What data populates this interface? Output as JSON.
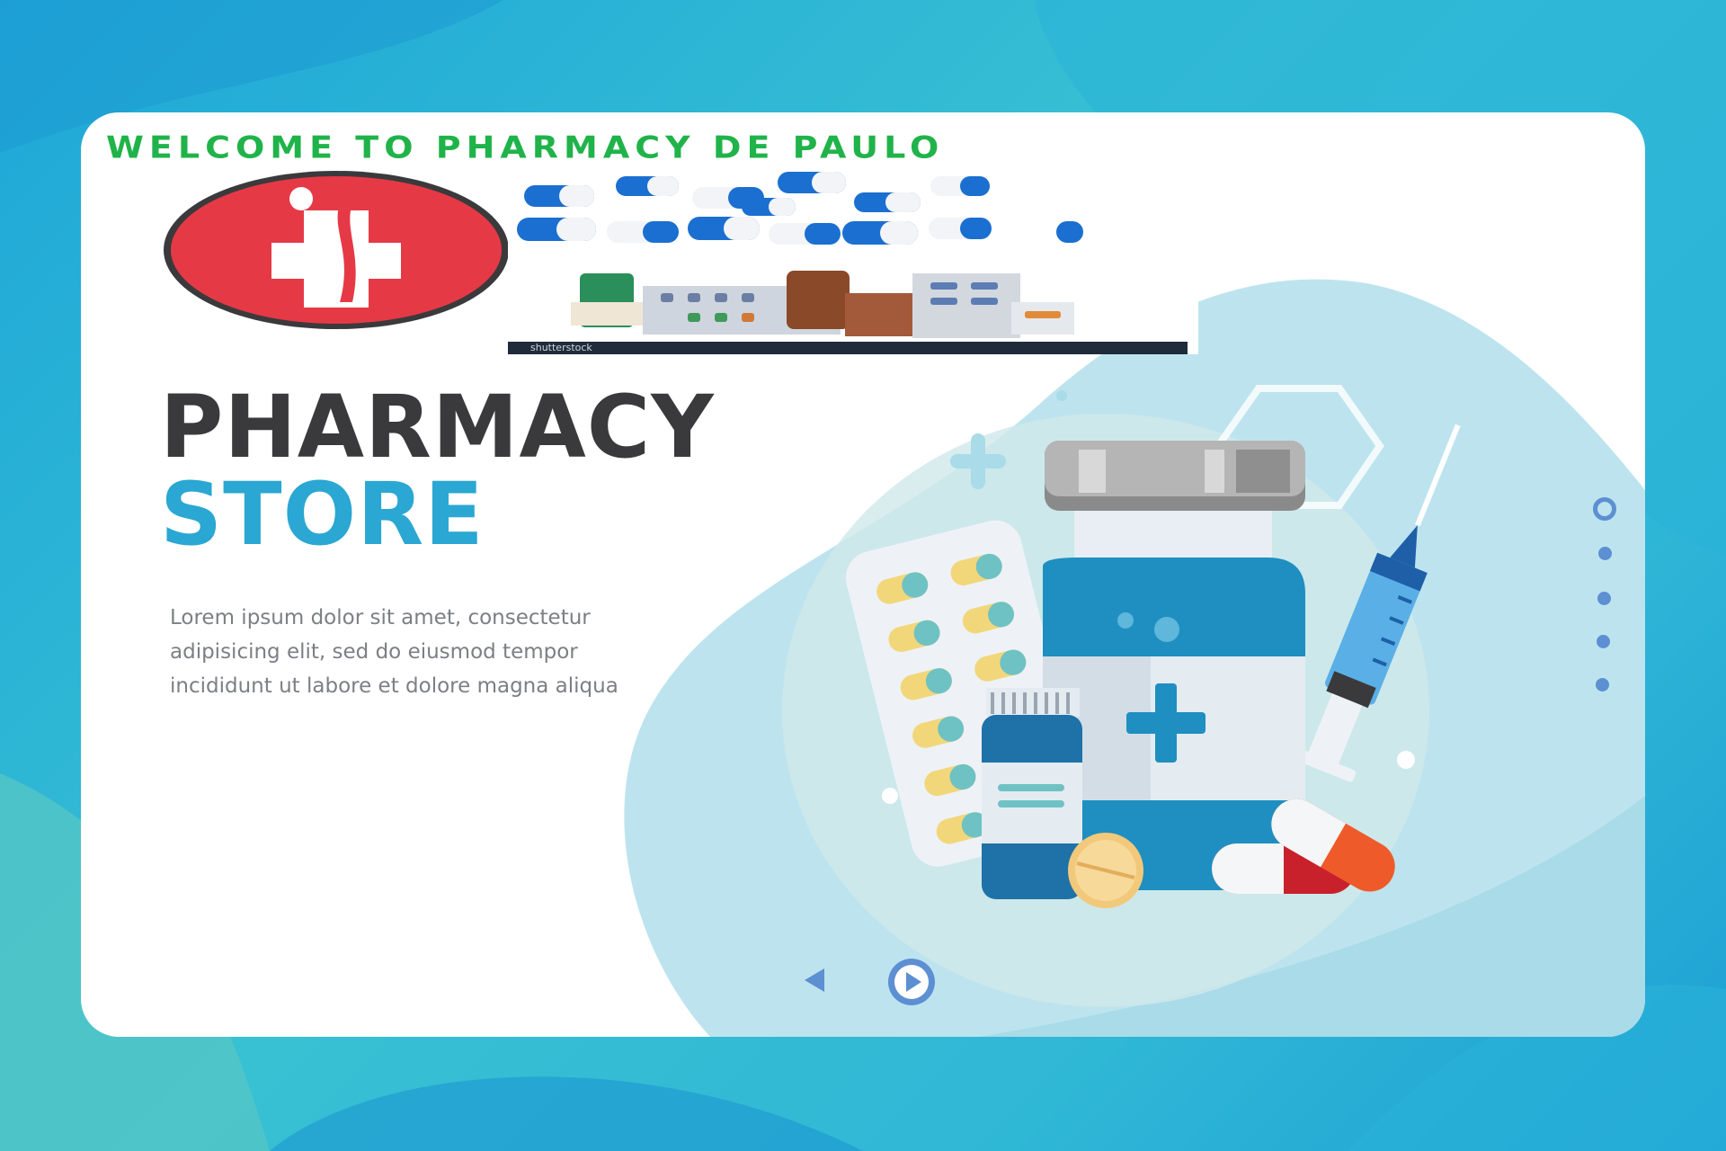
{
  "header": {
    "welcome_text": "WELCOME TO PHARMACY DE PAULO"
  },
  "banner": {
    "photo_watermark": "shutterstock"
  },
  "hero": {
    "title_line1": "PHARMACY",
    "title_line2": "STORE",
    "description": "Lorem ipsum dolor sit amet, consectetur adipisicing elit, sed do eiusmod tempor incididunt ut labore et dolore magna aliqua"
  },
  "colors": {
    "accent_blue": "#2aa7d2",
    "title_dark": "#3a3a3c",
    "welcome_green": "#20b34a",
    "logo_red": "#e63946",
    "nav_blue": "#5d8fd3"
  },
  "icons": {
    "logo": "medical-cross-logo-icon",
    "prev": "chevron-left-icon",
    "next": "play-right-icon"
  },
  "slider": {
    "dot_count": 5,
    "active_index": 0
  }
}
